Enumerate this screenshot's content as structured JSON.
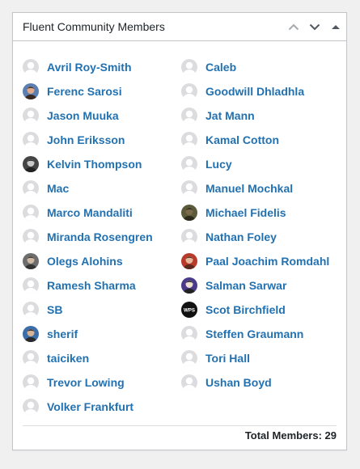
{
  "widget": {
    "title": "Fluent Community Members",
    "total_label": "Total Members: 29"
  },
  "colors": {
    "link": "#2271b1",
    "avatar_default_bg": "#dcdcde",
    "avatar_default_fg": "#ffffff"
  },
  "members": [
    {
      "name": "Avril Roy-Smith",
      "avatar": "default"
    },
    {
      "name": "Caleb",
      "avatar": "default"
    },
    {
      "name": "Ferenc Sarosi",
      "avatar": "photo-face"
    },
    {
      "name": "Goodwill Dhladhla",
      "avatar": "default"
    },
    {
      "name": "Jason Muuka",
      "avatar": "default"
    },
    {
      "name": "Jat Mann",
      "avatar": "default"
    },
    {
      "name": "John Eriksson",
      "avatar": "default"
    },
    {
      "name": "Kamal Cotton",
      "avatar": "default"
    },
    {
      "name": "Kelvin Thompson",
      "avatar": "photo-dark"
    },
    {
      "name": "Lucy",
      "avatar": "default"
    },
    {
      "name": "Mac",
      "avatar": "default"
    },
    {
      "name": "Manuel Mochkal",
      "avatar": "default"
    },
    {
      "name": "Marco Mandaliti",
      "avatar": "default"
    },
    {
      "name": "Michael Fidelis",
      "avatar": "photo-olive"
    },
    {
      "name": "Miranda Rosengren",
      "avatar": "default"
    },
    {
      "name": "Nathan Foley",
      "avatar": "default"
    },
    {
      "name": "Olegs Alohins",
      "avatar": "photo-gray"
    },
    {
      "name": "Paal Joachim Romdahl",
      "avatar": "photo-red"
    },
    {
      "name": "Ramesh Sharma",
      "avatar": "default"
    },
    {
      "name": "Salman Sarwar",
      "avatar": "photo-purple"
    },
    {
      "name": "SB",
      "avatar": "default"
    },
    {
      "name": "Scot Birchfield",
      "avatar": "wps-logo",
      "avatar_text": "WPS"
    },
    {
      "name": "sherif",
      "avatar": "photo-blue"
    },
    {
      "name": "Steffen Graumann",
      "avatar": "default"
    },
    {
      "name": "taiciken",
      "avatar": "default"
    },
    {
      "name": "Tori Hall",
      "avatar": "default"
    },
    {
      "name": "Trevor Lowing",
      "avatar": "default"
    },
    {
      "name": "Ushan Boyd",
      "avatar": "default"
    },
    {
      "name": "Volker Frankfurt",
      "avatar": "default"
    }
  ]
}
